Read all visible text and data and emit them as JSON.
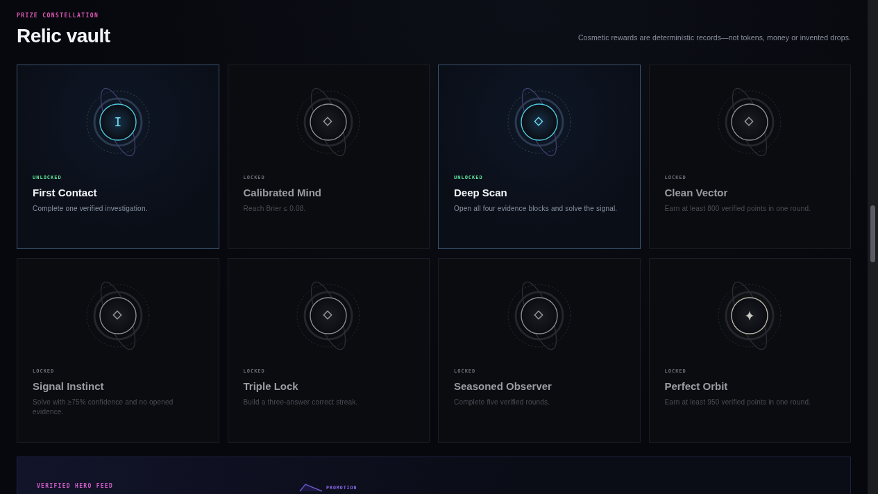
{
  "header": {
    "eyebrow": "PRIZE CONSTELLATION",
    "title": "Relic vault",
    "note": "Cosmetic rewards are deterministic records—not tokens, money or invented drops."
  },
  "relics": [
    {
      "status": "UNLOCKED",
      "unlocked": true,
      "title": "First Contact",
      "description": "Complete one verified investigation.",
      "emblem": {
        "kind": "letter",
        "text": "I"
      }
    },
    {
      "status": "LOCKED",
      "unlocked": false,
      "title": "Calibrated Mind",
      "description": "Reach Brier ≤ 0.08.",
      "emblem": {
        "kind": "diamond"
      }
    },
    {
      "status": "UNLOCKED",
      "unlocked": true,
      "title": "Deep Scan",
      "description": "Open all four evidence blocks and solve the signal.",
      "emblem": {
        "kind": "diamond"
      }
    },
    {
      "status": "LOCKED",
      "unlocked": false,
      "title": "Clean Vector",
      "description": "Earn at least 800 verified points in one round.",
      "emblem": {
        "kind": "diamond"
      }
    },
    {
      "status": "LOCKED",
      "unlocked": false,
      "title": "Signal Instinct",
      "description": "Solve with ≥75% confidence and no opened evidence.",
      "emblem": {
        "kind": "diamond"
      }
    },
    {
      "status": "LOCKED",
      "unlocked": false,
      "title": "Triple Lock",
      "description": "Build a three-answer correct streak.",
      "emblem": {
        "kind": "diamond"
      }
    },
    {
      "status": "LOCKED",
      "unlocked": false,
      "title": "Seasoned Observer",
      "description": "Complete five verified rounds.",
      "emblem": {
        "kind": "diamond"
      }
    },
    {
      "status": "LOCKED",
      "unlocked": false,
      "title": "Perfect Orbit",
      "description": "Earn at least 950 verified points in one round.",
      "emblem": {
        "kind": "star"
      }
    }
  ],
  "feed": {
    "eyebrow": "VERIFIED HERO FEED",
    "tag": "PROMOTION"
  }
}
